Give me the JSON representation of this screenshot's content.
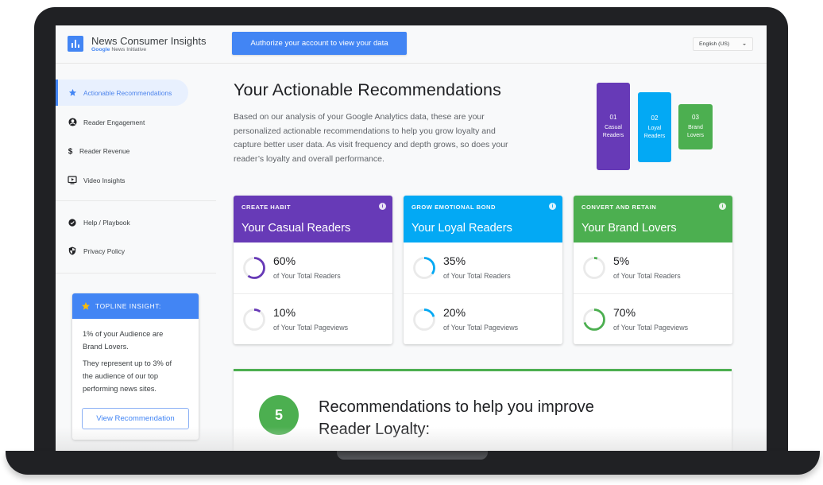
{
  "app": {
    "title": "News Consumer Insights",
    "subtitle_brand": "Google",
    "subtitle": "News Initiative"
  },
  "header": {
    "authorize_button": "Authorize your account to view your data",
    "language": {
      "selected": "English (US)"
    }
  },
  "sidebar": {
    "items": [
      {
        "label": "Actionable Recommendations",
        "icon": "star-icon",
        "active": true
      },
      {
        "label": "Reader Engagement",
        "icon": "account-circle-icon",
        "active": false
      },
      {
        "label": "Reader Revenue",
        "icon": "dollar-icon",
        "active": false
      },
      {
        "label": "Video Insights",
        "icon": "video-icon",
        "active": false
      }
    ],
    "secondary_items": [
      {
        "label": "Help / Playbook",
        "icon": "check-circle-icon"
      },
      {
        "label": "Privacy Policy",
        "icon": "shield-icon"
      }
    ]
  },
  "topline": {
    "title": "TOPLINE INSIGHT:",
    "paragraph1": [
      "1% of your Audience are",
      "Brand Lovers."
    ],
    "paragraph2": [
      "They represent up to 3% of",
      "the audience of our top",
      "performing news sites."
    ],
    "button": "View Recommendation"
  },
  "main": {
    "title": "Your Actionable Recommendations",
    "description_lines": [
      "Based on our analysis of your Google Analytics data, these are your",
      "personalized actionable recommendations to help you grow loyalty and",
      "capture better user data. As visit frequency and depth grows, so does your",
      "reader’s loyalty and overall performance."
    ],
    "segments": [
      {
        "num": "01",
        "line1": "Casual",
        "line2": "Readers",
        "color": "#673ab7"
      },
      {
        "num": "02",
        "line1": "Loyal",
        "line2": "Readers",
        "color": "#03a9f4"
      },
      {
        "num": "03",
        "line1": "Brand",
        "line2": "Lovers",
        "color": "#4caf50"
      }
    ],
    "cards": [
      {
        "kicker": "CREATE HABIT",
        "title": "Your Casual Readers",
        "color": "#673ab7",
        "stats": [
          {
            "value": "60%",
            "percent": 60,
            "label": "of Your Total Readers"
          },
          {
            "value": "10%",
            "percent": 10,
            "label": "of Your Total Pageviews"
          }
        ]
      },
      {
        "kicker": "GROW EMOTIONAL BOND",
        "title": "Your Loyal Readers",
        "color": "#03a9f4",
        "stats": [
          {
            "value": "35%",
            "percent": 35,
            "label": "of Your Total Readers"
          },
          {
            "value": "20%",
            "percent": 20,
            "label": "of Your Total Pageviews"
          }
        ]
      },
      {
        "kicker": "CONVERT AND RETAIN",
        "title": "Your Brand Lovers",
        "color": "#4caf50",
        "stats": [
          {
            "value": "5%",
            "percent": 5,
            "label": "of Your Total Readers"
          },
          {
            "value": "70%",
            "percent": 70,
            "label": "of Your Total Pageviews"
          }
        ]
      }
    ],
    "info_glyph": "i",
    "recommendations": {
      "count": "5",
      "line1": "Recommendations to help you improve",
      "line2": "Reader Loyalty:",
      "color": "#4caf50"
    }
  },
  "colors": {
    "accent": "#4285f4",
    "ring_track": "#eaeaea",
    "star": "#fbbc04"
  }
}
